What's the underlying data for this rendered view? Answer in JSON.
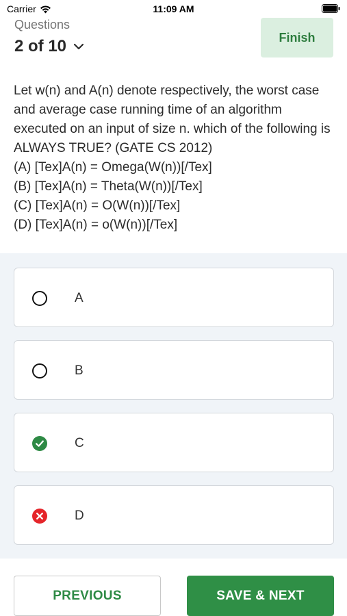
{
  "status_bar": {
    "carrier": "Carrier",
    "time": "11:09 AM"
  },
  "header": {
    "label": "Questions",
    "counter": "2 of 10",
    "finish_label": "Finish"
  },
  "question": {
    "text": "Let w(n) and A(n) denote respectively, the worst case and average case running time of an algorithm executed on an input of size n. which of the following is ALWAYS TRUE? (GATE CS 2012)",
    "option_lines": [
      "(A) [Tex]A(n) = Omega(W(n))[/Tex]",
      "(B) [Tex]A(n) = Theta(W(n))[/Tex]",
      "(C) [Tex]A(n) = O(W(n))[/Tex]",
      "(D) [Tex]A(n) = o(W(n))[/Tex]"
    ]
  },
  "answers": [
    {
      "label": "A",
      "state": "unselected"
    },
    {
      "label": "B",
      "state": "unselected"
    },
    {
      "label": "C",
      "state": "correct"
    },
    {
      "label": "D",
      "state": "incorrect"
    }
  ],
  "footer": {
    "previous_label": "PREVIOUS",
    "next_label": "SAVE & NEXT"
  },
  "colors": {
    "accent_green": "#2f8f46",
    "finish_bg": "#dbefe0",
    "correct_green": "#2e8a45",
    "incorrect_red": "#e5252a",
    "answers_bg": "#f0f4f8"
  },
  "icons": {
    "wifi": "wifi-icon",
    "battery": "battery-icon",
    "chevron": "chevron-down-icon",
    "correct": "check-circle-icon",
    "incorrect": "x-circle-icon",
    "radio": "radio-icon"
  }
}
